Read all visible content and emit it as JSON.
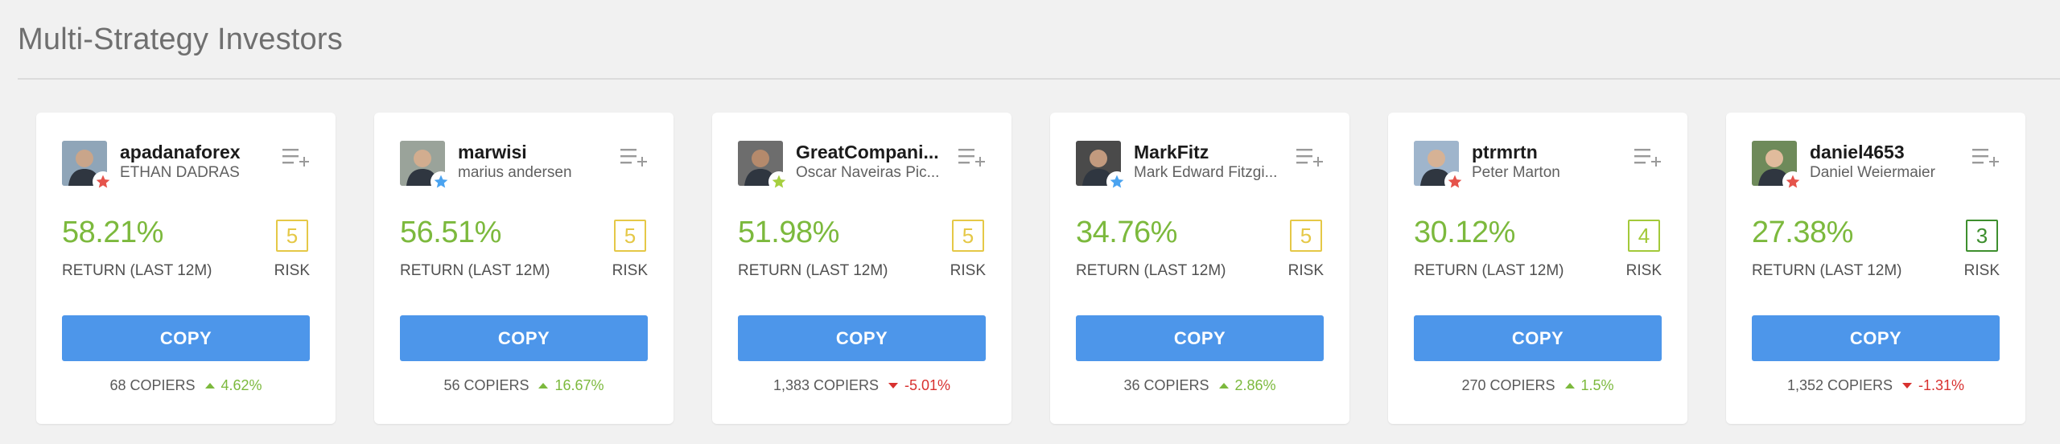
{
  "section": {
    "title": "Multi-Strategy Investors"
  },
  "labels": {
    "return_label": "RETURN (LAST 12M)",
    "risk_label": "RISK",
    "copy_label": "COPY"
  },
  "colors": {
    "return_green": "#7cb93d",
    "copy_blue": "#4d96ea",
    "risk_yellow": "#e5c847",
    "risk_light_green": "#a3c93a",
    "risk_dark_green": "#3e8f2e",
    "down_red": "#d8312f"
  },
  "investors": [
    {
      "username": "apadanaforex",
      "full_name": "ETHAN DADRAS",
      "return_12m": "58.21%",
      "risk": "5",
      "copiers": "68 COPIERS",
      "copiers_change": "4.62%",
      "trend": "up",
      "badge_color": "#e5534b",
      "avatar_icon": "user-photo"
    },
    {
      "username": "marwisi",
      "full_name": "marius andersen",
      "return_12m": "56.51%",
      "risk": "5",
      "copiers": "56 COPIERS",
      "copiers_change": "16.67%",
      "trend": "up",
      "badge_color": "#4aa3f0",
      "avatar_icon": "user-photo"
    },
    {
      "username": "GreatCompani...",
      "full_name": "Oscar Naveiras Pic...",
      "return_12m": "51.98%",
      "risk": "5",
      "copiers": "1,383 COPIERS",
      "copiers_change": "-5.01%",
      "trend": "down",
      "badge_color": "#a6cf3f",
      "avatar_icon": "user-photo"
    },
    {
      "username": "MarkFitz",
      "full_name": "Mark Edward Fitzgi...",
      "return_12m": "34.76%",
      "risk": "5",
      "copiers": "36 COPIERS",
      "copiers_change": "2.86%",
      "trend": "up",
      "badge_color": "#4aa3f0",
      "avatar_icon": "user-photo"
    },
    {
      "username": "ptrmrtn",
      "full_name": "Peter Marton",
      "return_12m": "30.12%",
      "risk": "4",
      "copiers": "270 COPIERS",
      "copiers_change": "1.5%",
      "trend": "up",
      "badge_color": "#e5534b",
      "avatar_icon": "user-photo"
    },
    {
      "username": "daniel4653",
      "full_name": "Daniel Weiermaier",
      "return_12m": "27.38%",
      "risk": "3",
      "copiers": "1,352 COPIERS",
      "copiers_change": "-1.31%",
      "trend": "down",
      "badge_color": "#e5534b",
      "avatar_icon": "user-photo"
    }
  ]
}
